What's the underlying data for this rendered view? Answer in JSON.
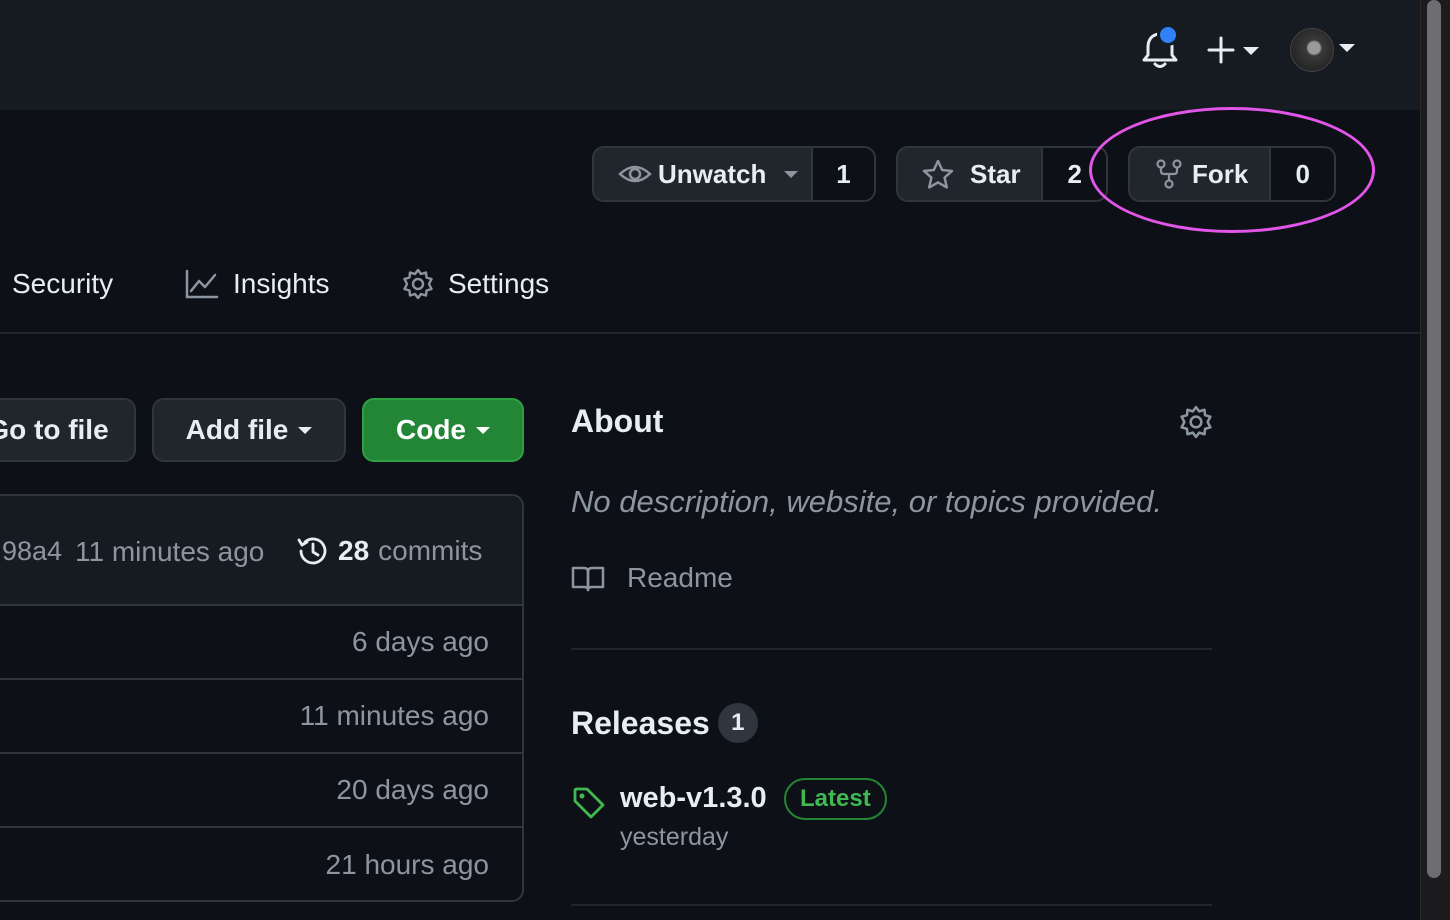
{
  "header": {
    "notifications_icon": "bell-icon",
    "notification_dot_color": "#2f81f7",
    "create_icon": "plus-icon"
  },
  "repo_actions": {
    "watch": {
      "label": "Unwatch",
      "count": "1",
      "icon": "eye-icon"
    },
    "star": {
      "label": "Star",
      "count": "2",
      "icon": "star-icon"
    },
    "fork": {
      "label": "Fork",
      "count": "0",
      "icon": "repo-forked-icon"
    }
  },
  "annotation": {
    "shape": "ellipse",
    "color": "#e255e9",
    "target": "fork"
  },
  "repo_tabs": [
    {
      "label": "Security",
      "icon": ""
    },
    {
      "label": "Insights",
      "icon": "graph-icon"
    },
    {
      "label": "Settings",
      "icon": "gear-icon"
    }
  ],
  "file_toolbar": {
    "go_to_file": "Go to file",
    "add_file": "Add file",
    "code": "Code"
  },
  "latest_commit": {
    "sha_fragment": "98a4",
    "time": "11 minutes ago",
    "commit_count": "28",
    "commit_label": "commits"
  },
  "file_rows": [
    {
      "time": "6 days ago"
    },
    {
      "time": "11 minutes ago"
    },
    {
      "time": "20 days ago"
    },
    {
      "time": "21 hours ago"
    }
  ],
  "about": {
    "title": "About",
    "description": "No description, website, or topics provided.",
    "readme_label": "Readme"
  },
  "releases": {
    "title": "Releases",
    "count": "1",
    "latest": {
      "name": "web-v1.3.0",
      "badge": "Latest",
      "date": "yesterday"
    }
  },
  "colors": {
    "background": "#0d1117",
    "header": "#161b22",
    "border": "#30363d",
    "green_button": "#238636",
    "latest_badge": "#3fb950"
  }
}
